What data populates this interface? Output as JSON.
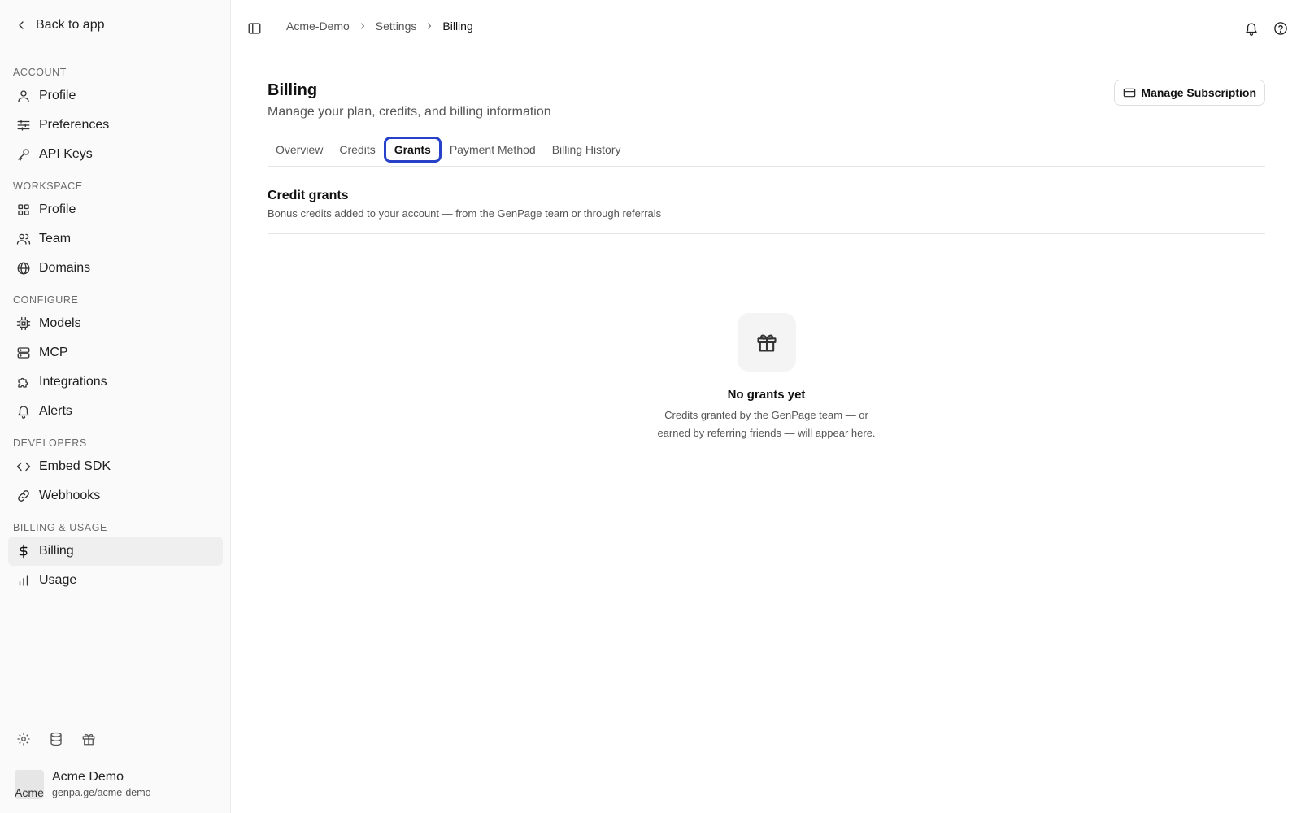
{
  "sidebar": {
    "back_label": "Back to app",
    "sections": [
      {
        "title": "ACCOUNT",
        "items": [
          {
            "label": "Profile",
            "icon": "user-icon"
          },
          {
            "label": "Preferences",
            "icon": "sliders-icon"
          },
          {
            "label": "API Keys",
            "icon": "key-icon"
          }
        ]
      },
      {
        "title": "WORKSPACE",
        "items": [
          {
            "label": "Profile",
            "icon": "grid-icon"
          },
          {
            "label": "Team",
            "icon": "users-icon"
          },
          {
            "label": "Domains",
            "icon": "globe-icon"
          }
        ]
      },
      {
        "title": "CONFIGURE",
        "items": [
          {
            "label": "Models",
            "icon": "cpu-icon"
          },
          {
            "label": "MCP",
            "icon": "server-icon"
          },
          {
            "label": "Integrations",
            "icon": "puzzle-icon"
          },
          {
            "label": "Alerts",
            "icon": "bell-icon"
          }
        ]
      },
      {
        "title": "DEVELOPERS",
        "items": [
          {
            "label": "Embed SDK",
            "icon": "code-icon"
          },
          {
            "label": "Webhooks",
            "icon": "link-icon"
          }
        ]
      },
      {
        "title": "BILLING & USAGE",
        "items": [
          {
            "label": "Billing",
            "icon": "dollar-icon",
            "active": true
          },
          {
            "label": "Usage",
            "icon": "bar-chart-icon"
          }
        ]
      }
    ],
    "footer_icons": [
      "settings-icon",
      "database-icon",
      "gift-icon"
    ],
    "account": {
      "name": "Acme Demo",
      "url": "genpa.ge/acme-demo",
      "avatar_alt": "Acme"
    }
  },
  "header": {
    "breadcrumb": [
      "Acme-Demo",
      "Settings",
      "Billing"
    ],
    "icons": [
      "bell-icon",
      "help-icon"
    ]
  },
  "main": {
    "title": "Billing",
    "subtitle": "Manage your plan, credits, and billing information",
    "manage_button": "Manage Subscription",
    "tabs": [
      {
        "label": "Overview"
      },
      {
        "label": "Credits"
      },
      {
        "label": "Grants",
        "active": true
      },
      {
        "label": "Payment Method"
      },
      {
        "label": "Billing History"
      }
    ],
    "section": {
      "title": "Credit grants",
      "description": "Bonus credits added to your account — from the GenPage team or through referrals"
    },
    "empty_state": {
      "icon": "gift-icon",
      "title": "No grants yet",
      "line1": "Credits granted by the GenPage team — or",
      "line2": "earned by referring friends — will appear here."
    }
  },
  "colors": {
    "focus_ring": "#2741c9",
    "sidebar_bg": "#fafafa",
    "active_item_bg": "#efefef"
  }
}
